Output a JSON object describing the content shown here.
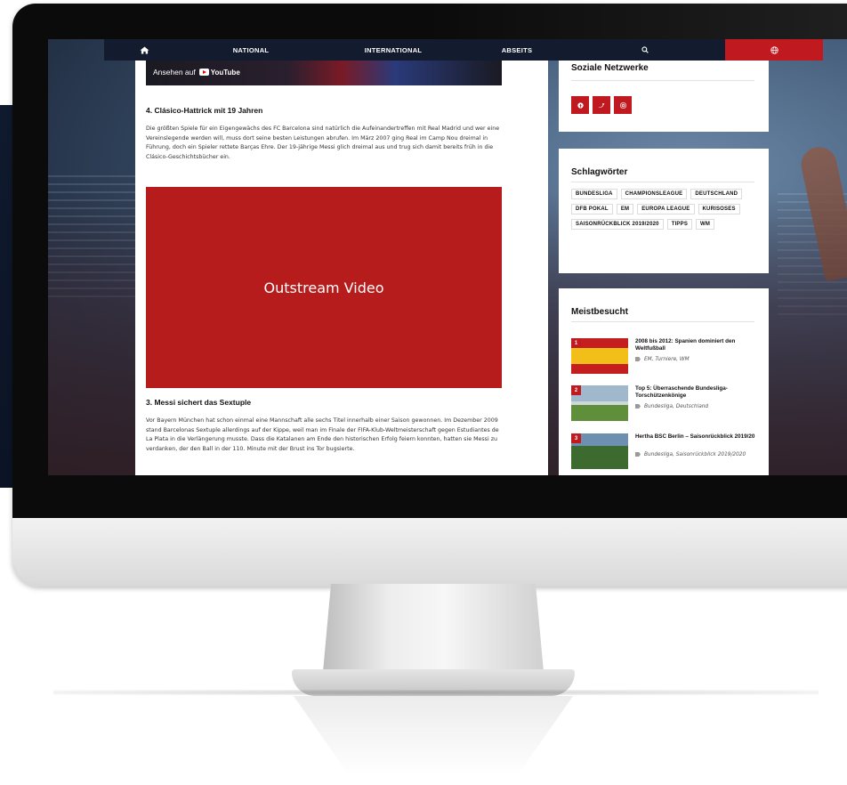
{
  "nav": {
    "national": "NATIONAL",
    "international": "INTERNATIONAL",
    "abseits": "ABSEITS",
    "home_icon": "home-icon",
    "search_icon": "search-icon",
    "globe_icon": "globe-icon"
  },
  "youtube": {
    "watch_on": "Ansehen auf",
    "brand": "YouTube"
  },
  "article": {
    "section4_title": "4. Clásico-Hattrick mit 19 Jahren",
    "section4_text": "Die größten Spiele für ein Eigengewächs des FC Barcelona sind natürlich die Aufeinandertreffen mit Real Madrid und wer eine Vereinslegende werden will, muss dort seine besten Leistungen abrufen. Im März 2007 ging Real im Camp Nou dreimal in Führung, doch ein Spieler rettete Barças Ehre. Der 19-jährige Messi glich dreimal aus und trug sich damit bereits früh in die Clásico-Geschichtsbücher ein.",
    "video_label": "Outstream Video",
    "section3_title": "3. Messi sichert das Sextuple",
    "section3_text": "Vor Bayern München hat schon einmal eine Mannschaft alle sechs Titel innerhalb einer Saison gewonnen. Im Dezember 2009 stand Barcelonas Sextuple allerdings auf der Kippe, weil man im Finale der FIFA-Klub-Weltmeisterschaft gegen Estudiantes de La Plata in die Verlängerung musste. Dass die Katalanen am Ende den historischen Erfolg feiern konnten, hatten sie Messi zu verdanken, der den Ball in der 110. Minute mit der Brust ins Tor bugsierte."
  },
  "sidebar": {
    "social_title": "Soziale Netzwerke",
    "social_icons": [
      "facebook-icon",
      "twitter-icon",
      "instagram-icon"
    ],
    "tags_title": "Schlagwörter",
    "tags": [
      "BUNDESLIGA",
      "CHAMPIONSLEAGUE",
      "DEUTSCHLAND",
      "DFB POKAL",
      "EM",
      "EUROPA LEAGUE",
      "KURISOSES",
      "SAISONRÜCKBLICK 2019/2020",
      "TIPPS",
      "WM"
    ],
    "most_title": "Meistbesucht",
    "most": [
      {
        "num": "1",
        "title": "2008 bis 2012: Spanien dominiert den Weltfußball",
        "tags": "EM, Turniere, WM"
      },
      {
        "num": "2",
        "title": "Top 5: Überraschende Bundesliga-Torschützenkönige",
        "tags": "Bundesliga, Deutschland"
      },
      {
        "num": "3",
        "title": "Hertha BSC Berlin – Saisonrückblick 2019/20",
        "tags": "Bundesliga, Saisonrückblick 2019/2020"
      }
    ]
  },
  "colors": {
    "brand_red": "#c0191f",
    "nav_dark": "#131b2e",
    "video_red": "#b71c1c"
  }
}
